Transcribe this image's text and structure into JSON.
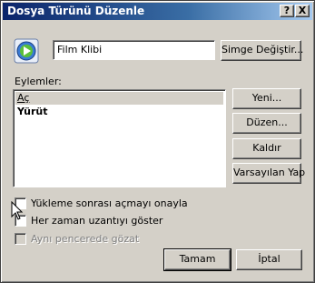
{
  "dialog": {
    "title": "Dosya Türünü Düzenle",
    "help_button": "?",
    "close_button": "X"
  },
  "file_type": {
    "icon": "media-player-icon",
    "name_value": "Film Klibi",
    "change_icon_label": "Simge Değiştir..."
  },
  "actions": {
    "label": "Eylemler:",
    "items": [
      "Aç",
      "Yürüt"
    ],
    "selected_index": 0,
    "default_index": 1
  },
  "side_buttons": {
    "new": "Yeni...",
    "edit": "Düzen...",
    "remove": "Kaldır",
    "set_default": "Varsayılan Yap"
  },
  "options": {
    "confirm_open": "Yükleme sonrası açmayı onayla",
    "always_show_ext": "Her zaman uzantıyı göster",
    "browse_same_window": "Aynı pencerede gözat"
  },
  "footer": {
    "ok": "Tamam",
    "cancel": "İptal"
  },
  "colors": {
    "face": "#d4d0c8",
    "title_start": "#0a246a",
    "title_end": "#a6caf0"
  }
}
